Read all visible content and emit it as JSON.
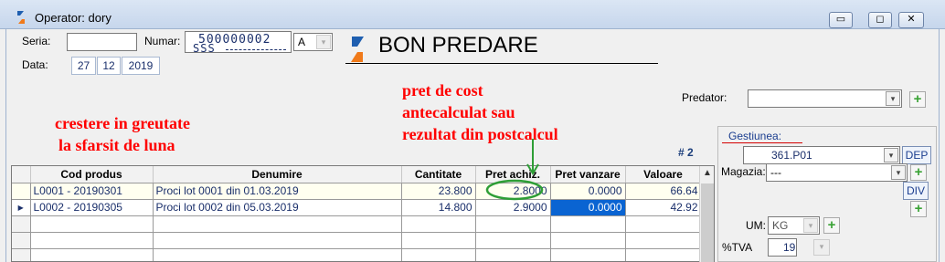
{
  "window": {
    "title": "Operator: dory",
    "min_glyph": "▭",
    "max_glyph": "◻",
    "close_glyph": "✕"
  },
  "header": {
    "seria_label": "Seria:",
    "seria_value": "",
    "numar_label": "Numar:",
    "numar_value": "500000002",
    "numar_prefix": "SSS",
    "numar_letter": "A",
    "data_label": "Data:",
    "date_day": "27",
    "date_month": "12",
    "date_year": "2019",
    "doc_title": "BON PREDARE",
    "predator_label": "Predator:",
    "predator_value": ""
  },
  "annotations": {
    "left": [
      "crestere in greutate",
      "la sfarsit de luna"
    ],
    "center": [
      "pret de cost",
      "antecalculat sau",
      "rezultat din postcalcul"
    ],
    "colors": {
      "text": "#ff0000",
      "circle": "#2e9e36"
    }
  },
  "grid": {
    "row_count_label": "# 2",
    "columns": [
      "Cod produs",
      "Denumire",
      "Cantitate",
      "Pret achiz.",
      "Pret vanzare",
      "Valoare"
    ],
    "rows": [
      {
        "indicator": "",
        "cod": "L0001 - 20190301",
        "denumire": "Proci lot 0001 din 01.03.2019",
        "cantitate": "23.800",
        "pret_achiz": "2.8000",
        "pret_vanzare": "0.0000",
        "valoare": "66.64"
      },
      {
        "indicator": "▶",
        "cod": "L0002 - 20190305",
        "denumire": "Proci lot 0002 din 05.03.2019",
        "cantitate": "14.800",
        "pret_achiz": "2.9000",
        "pret_vanzare": "0.0000",
        "valoare": "42.92"
      }
    ],
    "selection_color": "#0a64d2"
  },
  "side_panel": {
    "gestiunea_label": "Gestiunea:",
    "gestiunea_value": "361.P01",
    "dep_label": "DEP",
    "magazia_label": "Magazia:",
    "magazia_value": "---",
    "div_label": "DIV",
    "um_label": "UM:",
    "um_value": "KG",
    "tva_label": "%TVA",
    "tva_value": "19"
  },
  "icons": {
    "plus": "+",
    "dropdown": "▾",
    "scroll_up": "▲",
    "row_indicator": "▶"
  }
}
